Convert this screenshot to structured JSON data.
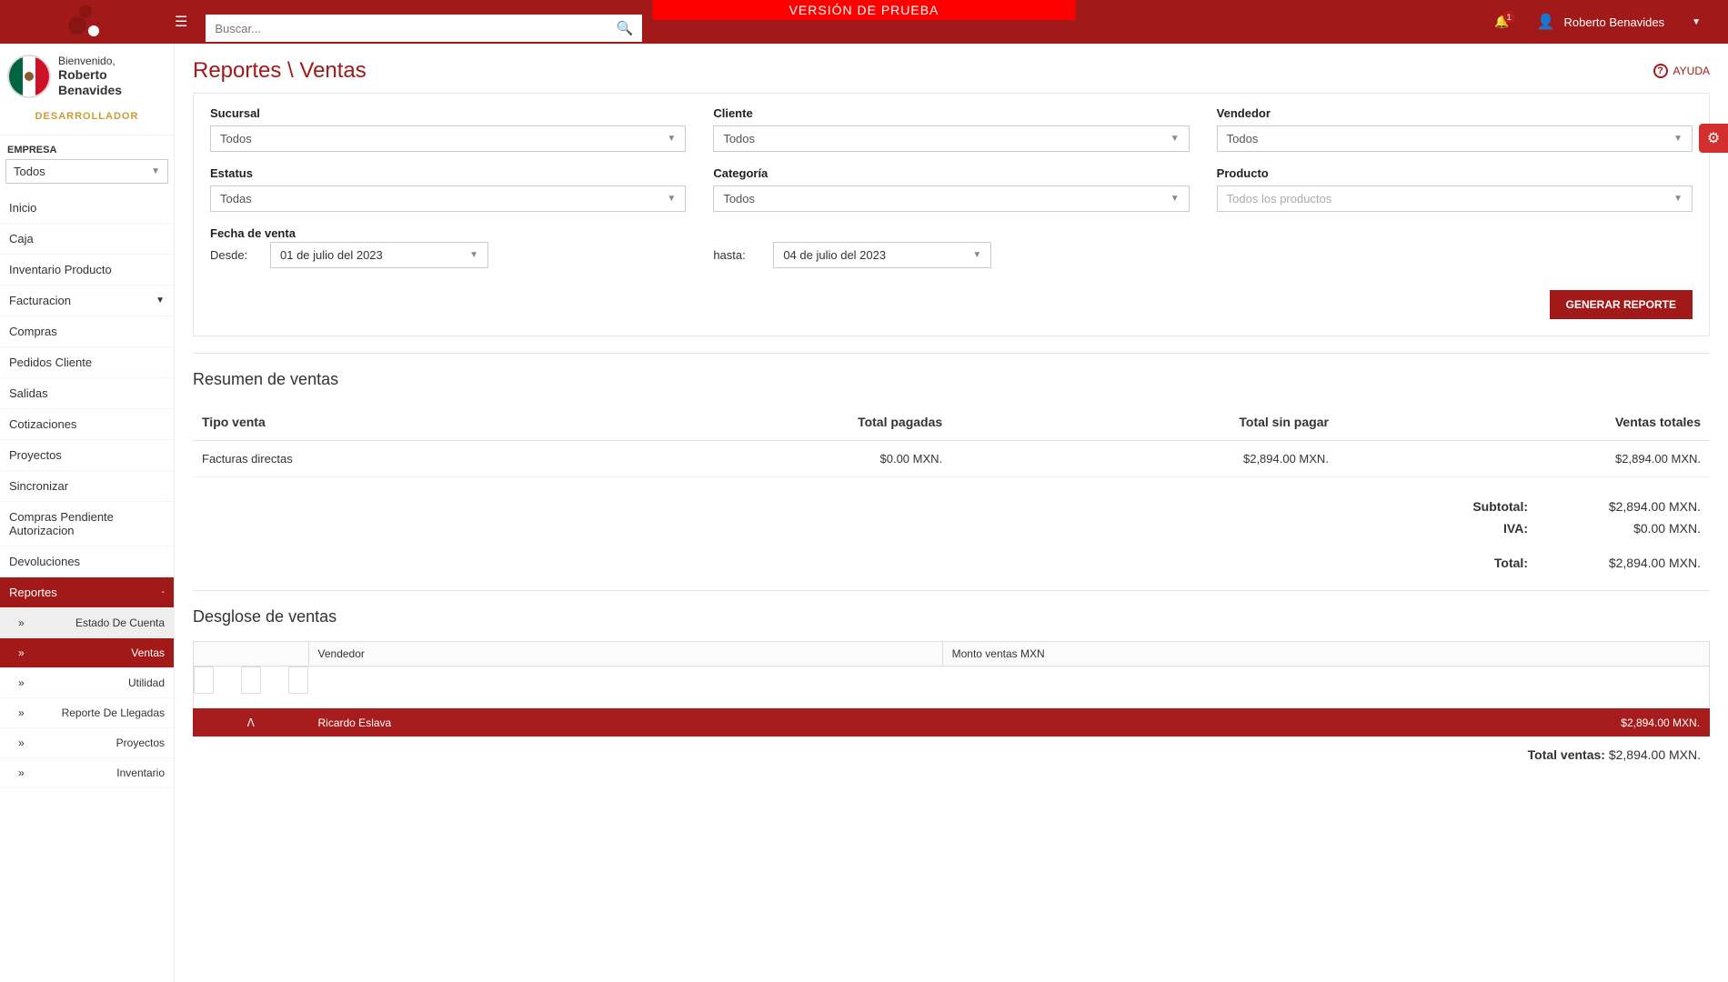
{
  "banner": "VERSIÓN DE PRUEBA",
  "search": {
    "placeholder": "Buscar..."
  },
  "notifications": {
    "count": "1"
  },
  "header_user": "Roberto Benavides",
  "sidebar": {
    "welcome": "Bienvenido,",
    "username": "Roberto Benavides",
    "role": "DESARROLLADOR",
    "empresa_label": "EMPRESA",
    "empresa_value": "Todos",
    "items": [
      "Inicio",
      "Caja",
      "Inventario Producto",
      "Facturacion",
      "Compras",
      "Pedidos Cliente",
      "Salidas",
      "Cotizaciones",
      "Proyectos",
      "Sincronizar",
      "Compras Pendiente Autorizacion",
      "Devoluciones",
      "Reportes"
    ],
    "subitems": [
      "Estado De Cuenta",
      "Ventas",
      "Utilidad",
      "Reporte De Llegadas",
      "Proyectos",
      "Inventario"
    ]
  },
  "page": {
    "title": "Reportes \\ Ventas",
    "help": "AYUDA"
  },
  "filters": {
    "sucursal_label": "Sucursal",
    "sucursal_value": "Todos",
    "cliente_label": "Cliente",
    "cliente_value": "Todos",
    "vendedor_label": "Vendedor",
    "vendedor_value": "Todos",
    "estatus_label": "Estatus",
    "estatus_value": "Todas",
    "categoria_label": "Categoría",
    "categoria_value": "Todos",
    "producto_label": "Producto",
    "producto_placeholder": "Todos los productos",
    "fecha_label": "Fecha de venta",
    "desde_label": "Desde:",
    "desde_value": "01 de julio del  2023",
    "hasta_label": "hasta:",
    "hasta_value": "04 de julio del  2023",
    "generate_btn": "GENERAR REPORTE"
  },
  "summary": {
    "title": "Resumen de ventas",
    "headers": {
      "tipo": "Tipo venta",
      "pagadas": "Total pagadas",
      "sinpagar": "Total sin pagar",
      "totales": "Ventas totales"
    },
    "row": {
      "tipo": "Facturas directas",
      "pagadas": "$0.00 MXN.",
      "sinpagar": "$2,894.00 MXN.",
      "totales": "$2,894.00 MXN."
    },
    "subtotal_label": "Subtotal:",
    "subtotal_value": "$2,894.00 MXN.",
    "iva_label": "IVA:",
    "iva_value": "$0.00 MXN.",
    "total_label": "Total:",
    "total_value": "$2,894.00 MXN."
  },
  "breakdown": {
    "title": "Desglose de ventas",
    "headers": {
      "vendedor": "Vendedor",
      "monto": "Monto ventas MXN"
    },
    "seller": {
      "name": "Ricardo Eslava",
      "amount": "$2,894.00 MXN."
    }
  },
  "grand_total": {
    "label": "Total ventas:",
    "value": "$2,894.00 MXN."
  }
}
